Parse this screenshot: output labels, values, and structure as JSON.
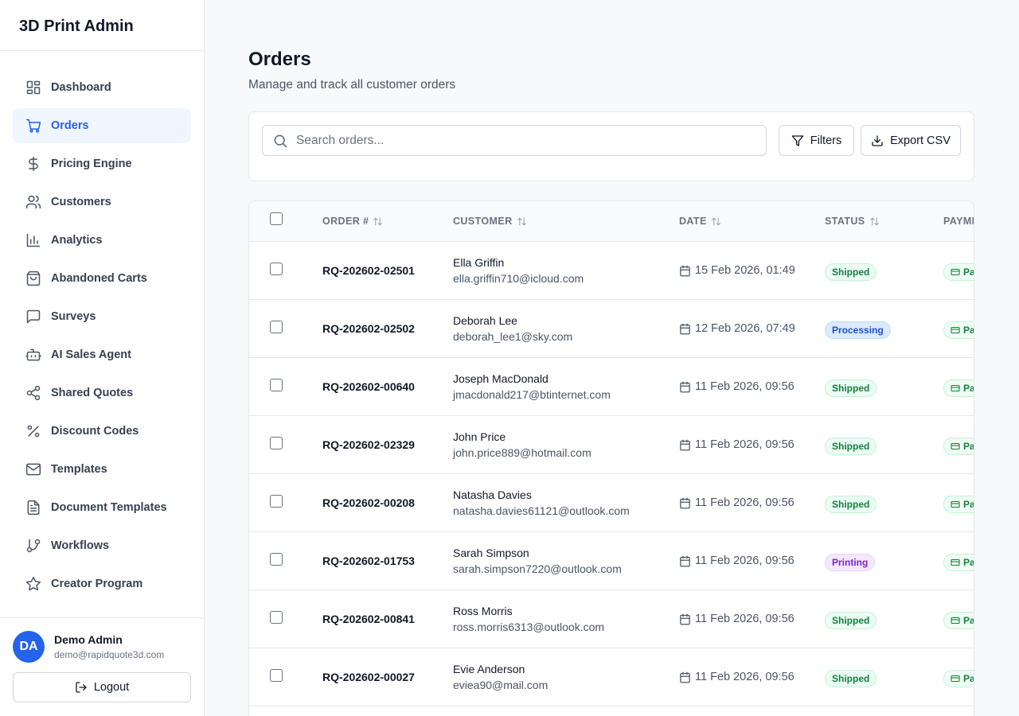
{
  "app": {
    "title": "3D Print Admin"
  },
  "nav": [
    {
      "label": "Dashboard",
      "icon": "dashboard-icon",
      "active": false
    },
    {
      "label": "Orders",
      "icon": "cart-icon",
      "active": true
    },
    {
      "label": "Pricing Engine",
      "icon": "dollar-icon",
      "active": false
    },
    {
      "label": "Customers",
      "icon": "users-icon",
      "active": false
    },
    {
      "label": "Analytics",
      "icon": "bar-chart-icon",
      "active": false
    },
    {
      "label": "Abandoned Carts",
      "icon": "shopping-bag-icon",
      "active": false
    },
    {
      "label": "Surveys",
      "icon": "message-square-icon",
      "active": false
    },
    {
      "label": "AI Sales Agent",
      "icon": "bot-icon",
      "active": false
    },
    {
      "label": "Shared Quotes",
      "icon": "share-icon",
      "active": false
    },
    {
      "label": "Discount Codes",
      "icon": "percent-icon",
      "active": false
    },
    {
      "label": "Templates",
      "icon": "mail-icon",
      "active": false
    },
    {
      "label": "Document Templates",
      "icon": "file-text-icon",
      "active": false
    },
    {
      "label": "Workflows",
      "icon": "git-branch-icon",
      "active": false
    },
    {
      "label": "Creator Program",
      "icon": "star-icon",
      "active": false
    }
  ],
  "user": {
    "initials": "DA",
    "name": "Demo Admin",
    "email": "demo@rapidquote3d.com",
    "logout_label": "Logout"
  },
  "page": {
    "title": "Orders",
    "subtitle": "Manage and track all customer orders"
  },
  "toolbar": {
    "search_placeholder": "Search orders...",
    "filters_label": "Filters",
    "export_label": "Export CSV"
  },
  "table": {
    "headers": {
      "order": "ORDER #",
      "customer": "CUSTOMER",
      "date": "DATE",
      "status": "STATUS",
      "payment": "PAYMENT"
    },
    "payment_visible": "Pa",
    "rows": [
      {
        "order": "RQ-202602-02501",
        "name": "Ella Griffin",
        "email": "ella.griffin710@icloud.com",
        "date": "15 Feb 2026, 01:49",
        "status": "Shipped"
      },
      {
        "order": "RQ-202602-02502",
        "name": "Deborah Lee",
        "email": "deborah_lee1@sky.com",
        "date": "12 Feb 2026, 07:49",
        "status": "Processing"
      },
      {
        "order": "RQ-202602-00640",
        "name": "Joseph MacDonald",
        "email": "jmacdonald217@btinternet.com",
        "date": "11 Feb 2026, 09:56",
        "status": "Shipped"
      },
      {
        "order": "RQ-202602-02329",
        "name": "John Price",
        "email": "john.price889@hotmail.com",
        "date": "11 Feb 2026, 09:56",
        "status": "Shipped"
      },
      {
        "order": "RQ-202602-00208",
        "name": "Natasha Davies",
        "email": "natasha.davies61121@outlook.com",
        "date": "11 Feb 2026, 09:56",
        "status": "Shipped"
      },
      {
        "order": "RQ-202602-01753",
        "name": "Sarah Simpson",
        "email": "sarah.simpson7220@outlook.com",
        "date": "11 Feb 2026, 09:56",
        "status": "Printing"
      },
      {
        "order": "RQ-202602-00841",
        "name": "Ross Morris",
        "email": "ross.morris6313@outlook.com",
        "date": "11 Feb 2026, 09:56",
        "status": "Shipped"
      },
      {
        "order": "RQ-202602-00027",
        "name": "Evie Anderson",
        "email": "eviea90@mail.com",
        "date": "11 Feb 2026, 09:56",
        "status": "Shipped"
      }
    ]
  },
  "status_colors": {
    "Shipped": {
      "bg": "#ecfdf5",
      "fg": "#15803d",
      "border": "#bbf7d0"
    },
    "Processing": {
      "bg": "#dbeafe",
      "fg": "#1d4ed8",
      "border": "#bfdbfe"
    },
    "Printing": {
      "bg": "#f3e8ff",
      "fg": "#7e22ce",
      "border": "#e9d5ff"
    }
  },
  "colors": {
    "accent": "#2563eb",
    "active_bg": "#eff6ff"
  }
}
